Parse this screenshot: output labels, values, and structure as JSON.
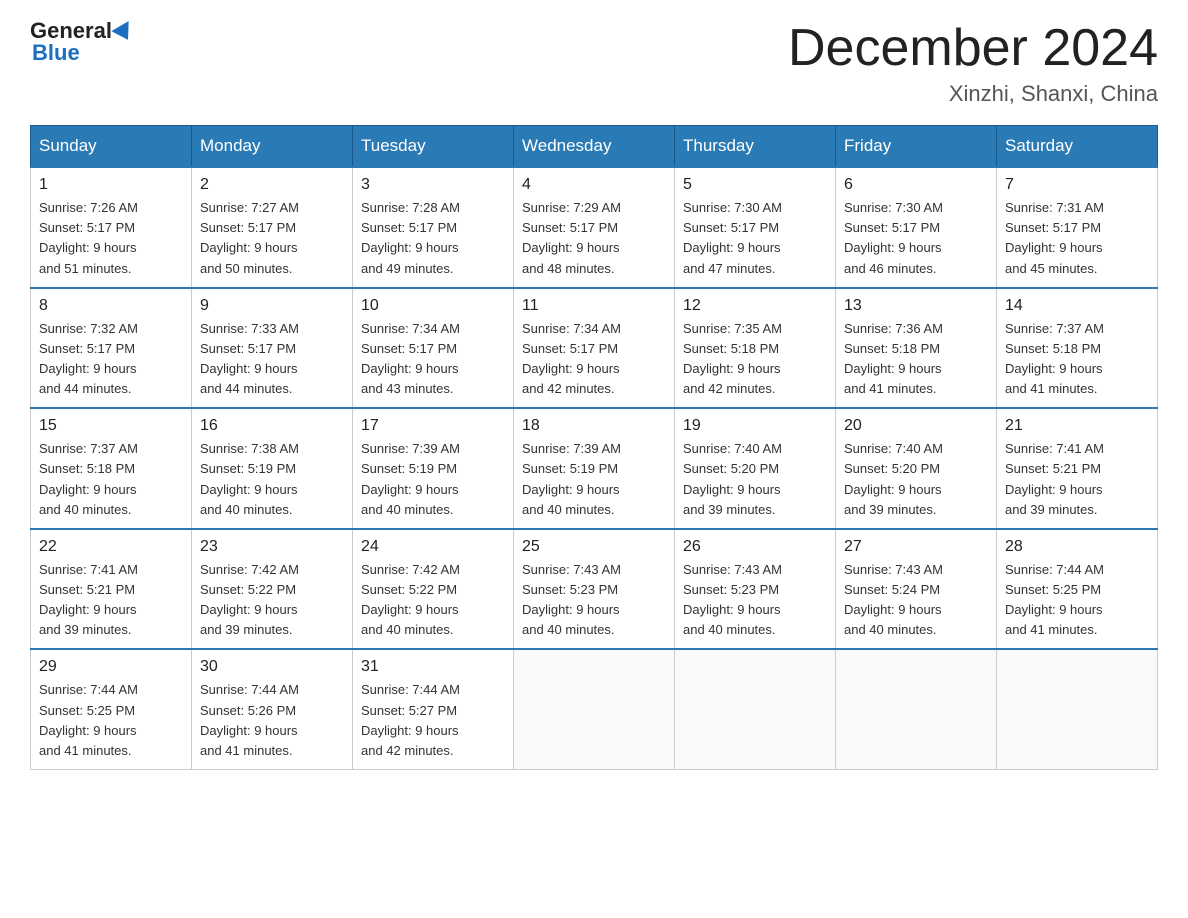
{
  "header": {
    "title": "December 2024",
    "subtitle": "Xinzhi, Shanxi, China",
    "logo_line1": "General",
    "logo_line2": "Blue"
  },
  "days_of_week": [
    "Sunday",
    "Monday",
    "Tuesday",
    "Wednesday",
    "Thursday",
    "Friday",
    "Saturday"
  ],
  "weeks": [
    [
      {
        "day": "1",
        "sunrise": "7:26 AM",
        "sunset": "5:17 PM",
        "daylight": "9 hours and 51 minutes."
      },
      {
        "day": "2",
        "sunrise": "7:27 AM",
        "sunset": "5:17 PM",
        "daylight": "9 hours and 50 minutes."
      },
      {
        "day": "3",
        "sunrise": "7:28 AM",
        "sunset": "5:17 PM",
        "daylight": "9 hours and 49 minutes."
      },
      {
        "day": "4",
        "sunrise": "7:29 AM",
        "sunset": "5:17 PM",
        "daylight": "9 hours and 48 minutes."
      },
      {
        "day": "5",
        "sunrise": "7:30 AM",
        "sunset": "5:17 PM",
        "daylight": "9 hours and 47 minutes."
      },
      {
        "day": "6",
        "sunrise": "7:30 AM",
        "sunset": "5:17 PM",
        "daylight": "9 hours and 46 minutes."
      },
      {
        "day": "7",
        "sunrise": "7:31 AM",
        "sunset": "5:17 PM",
        "daylight": "9 hours and 45 minutes."
      }
    ],
    [
      {
        "day": "8",
        "sunrise": "7:32 AM",
        "sunset": "5:17 PM",
        "daylight": "9 hours and 44 minutes."
      },
      {
        "day": "9",
        "sunrise": "7:33 AM",
        "sunset": "5:17 PM",
        "daylight": "9 hours and 44 minutes."
      },
      {
        "day": "10",
        "sunrise": "7:34 AM",
        "sunset": "5:17 PM",
        "daylight": "9 hours and 43 minutes."
      },
      {
        "day": "11",
        "sunrise": "7:34 AM",
        "sunset": "5:17 PM",
        "daylight": "9 hours and 42 minutes."
      },
      {
        "day": "12",
        "sunrise": "7:35 AM",
        "sunset": "5:18 PM",
        "daylight": "9 hours and 42 minutes."
      },
      {
        "day": "13",
        "sunrise": "7:36 AM",
        "sunset": "5:18 PM",
        "daylight": "9 hours and 41 minutes."
      },
      {
        "day": "14",
        "sunrise": "7:37 AM",
        "sunset": "5:18 PM",
        "daylight": "9 hours and 41 minutes."
      }
    ],
    [
      {
        "day": "15",
        "sunrise": "7:37 AM",
        "sunset": "5:18 PM",
        "daylight": "9 hours and 40 minutes."
      },
      {
        "day": "16",
        "sunrise": "7:38 AM",
        "sunset": "5:19 PM",
        "daylight": "9 hours and 40 minutes."
      },
      {
        "day": "17",
        "sunrise": "7:39 AM",
        "sunset": "5:19 PM",
        "daylight": "9 hours and 40 minutes."
      },
      {
        "day": "18",
        "sunrise": "7:39 AM",
        "sunset": "5:19 PM",
        "daylight": "9 hours and 40 minutes."
      },
      {
        "day": "19",
        "sunrise": "7:40 AM",
        "sunset": "5:20 PM",
        "daylight": "9 hours and 39 minutes."
      },
      {
        "day": "20",
        "sunrise": "7:40 AM",
        "sunset": "5:20 PM",
        "daylight": "9 hours and 39 minutes."
      },
      {
        "day": "21",
        "sunrise": "7:41 AM",
        "sunset": "5:21 PM",
        "daylight": "9 hours and 39 minutes."
      }
    ],
    [
      {
        "day": "22",
        "sunrise": "7:41 AM",
        "sunset": "5:21 PM",
        "daylight": "9 hours and 39 minutes."
      },
      {
        "day": "23",
        "sunrise": "7:42 AM",
        "sunset": "5:22 PM",
        "daylight": "9 hours and 39 minutes."
      },
      {
        "day": "24",
        "sunrise": "7:42 AM",
        "sunset": "5:22 PM",
        "daylight": "9 hours and 40 minutes."
      },
      {
        "day": "25",
        "sunrise": "7:43 AM",
        "sunset": "5:23 PM",
        "daylight": "9 hours and 40 minutes."
      },
      {
        "day": "26",
        "sunrise": "7:43 AM",
        "sunset": "5:23 PM",
        "daylight": "9 hours and 40 minutes."
      },
      {
        "day": "27",
        "sunrise": "7:43 AM",
        "sunset": "5:24 PM",
        "daylight": "9 hours and 40 minutes."
      },
      {
        "day": "28",
        "sunrise": "7:44 AM",
        "sunset": "5:25 PM",
        "daylight": "9 hours and 41 minutes."
      }
    ],
    [
      {
        "day": "29",
        "sunrise": "7:44 AM",
        "sunset": "5:25 PM",
        "daylight": "9 hours and 41 minutes."
      },
      {
        "day": "30",
        "sunrise": "7:44 AM",
        "sunset": "5:26 PM",
        "daylight": "9 hours and 41 minutes."
      },
      {
        "day": "31",
        "sunrise": "7:44 AM",
        "sunset": "5:27 PM",
        "daylight": "9 hours and 42 minutes."
      },
      null,
      null,
      null,
      null
    ]
  ]
}
